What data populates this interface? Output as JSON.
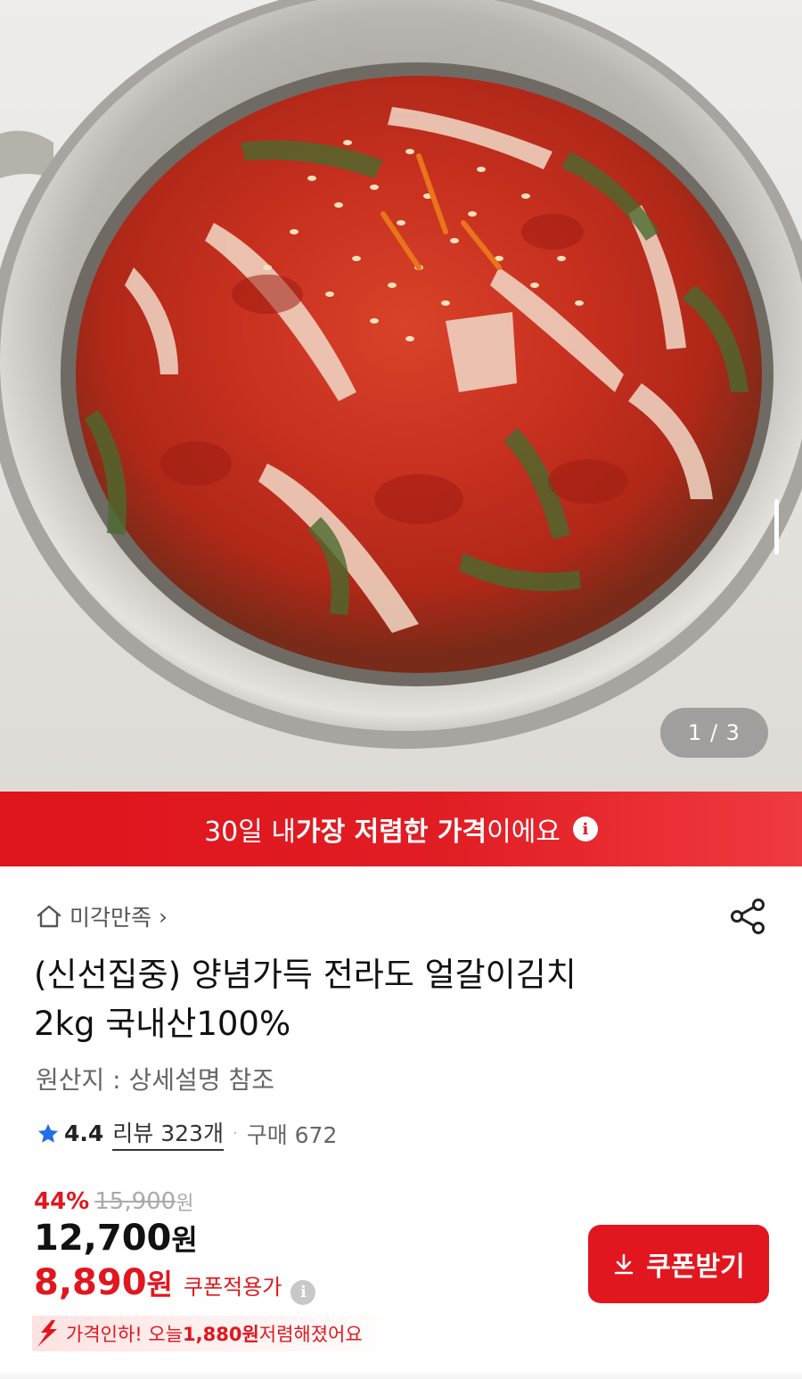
{
  "hero": {
    "image_alt": "kimchi in stainless bowl",
    "pager": "1 / 3"
  },
  "banner": {
    "prefix": "30일 내 ",
    "highlight": "가장 저렴한 가격",
    "suffix": "이에요",
    "info_icon": "info-icon",
    "background": "#e1161e"
  },
  "store": {
    "name": "미각만족",
    "home_icon": "home-icon",
    "chevron": "›",
    "share_icon": "share-icon"
  },
  "product": {
    "title_line1": "(신선집중) 양념가득 전라도 얼갈이김치",
    "title_line2": "2kg 국내산100%",
    "origin": "원산지 : 상세설명 참조"
  },
  "rating": {
    "score": "4.4",
    "reviews": "리뷰 323개",
    "purchases": "구매 672",
    "star_color": "#1f6fe5"
  },
  "price": {
    "discount_rate": "44%",
    "original": "15,900",
    "original_unit": "원",
    "sale": "12,700",
    "sale_unit": "원",
    "coupon_price": "8,890",
    "coupon_unit": "원",
    "coupon_label": "쿠폰적용가",
    "price_drop_prefix": "가격인하! 오늘 ",
    "price_drop_amount": "1,880원",
    "price_drop_suffix": " 저렴해졌어요",
    "accent": "#e1161e"
  },
  "actions": {
    "coupon_button": "쿠폰받기"
  }
}
